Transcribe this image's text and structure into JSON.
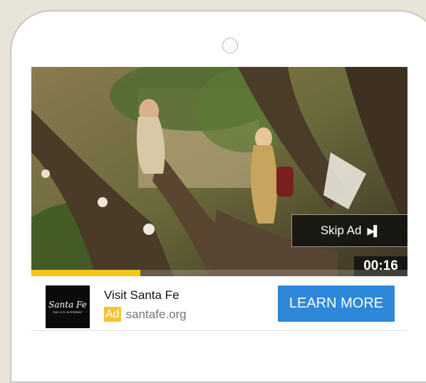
{
  "ad": {
    "skip_label": "Skip Ad",
    "skip_icon": "skip-next-icon",
    "timer": "00:16",
    "progress_fraction": 0.29,
    "progress_color": "#f5c518",
    "logo_text": "Santa Fe",
    "logo_tagline": "THE CITY DIFFERENT",
    "title": "Visit Santa Fe",
    "badge": "Ad",
    "badge_color": "#f4c430",
    "url": "santafe.org",
    "cta_label": "LEARN MORE",
    "cta_color": "#2d88d9"
  }
}
